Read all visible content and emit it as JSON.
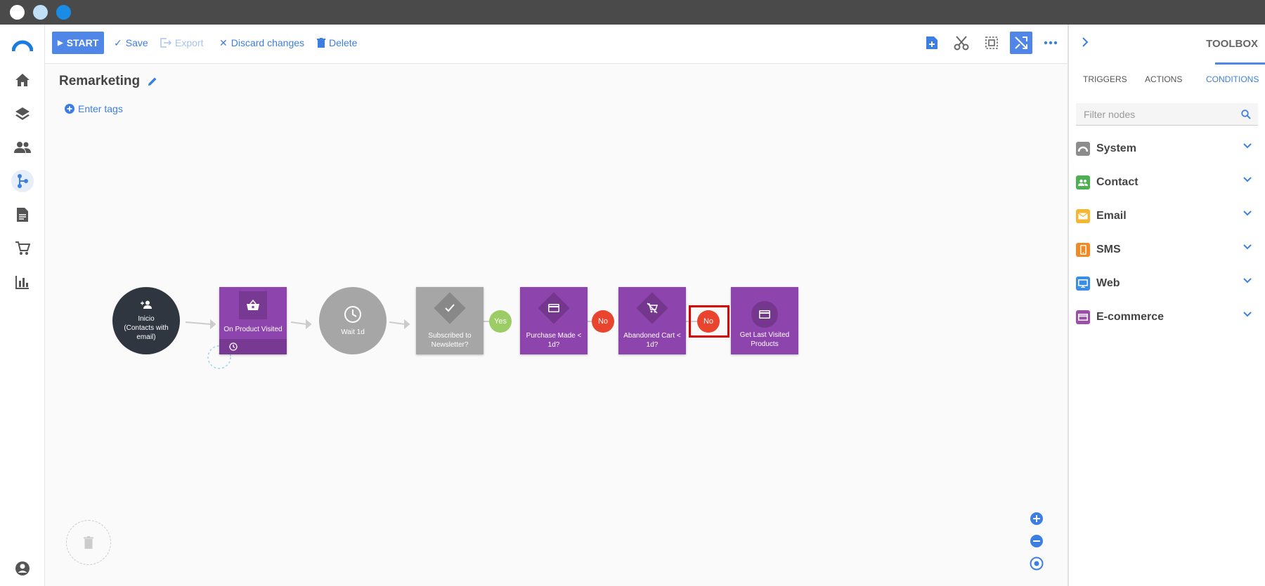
{
  "window": {
    "dots": [
      "#ffffff",
      "#bfe0f7",
      "#1a8ce6"
    ]
  },
  "toolbar": {
    "start_label": "START",
    "save_label": "Save",
    "export_label": "Export",
    "discard_label": "Discard changes",
    "delete_label": "Delete"
  },
  "flow": {
    "name": "Remarketing",
    "tags_label": "Enter tags",
    "nodes": {
      "start": "Inicio\n(Contacts with\nemail)",
      "product_visited": "On Product Visited",
      "wait": "Wait 1d",
      "subscribed": "Subscribed to\nNewsletter?",
      "purchase": "Purchase Made < 1d?",
      "abandoned": "Abandoned Cart < 1d?",
      "last_visited": "Get Last Visited\nProducts"
    },
    "branches": {
      "yes": "Yes",
      "no1": "No",
      "no2": "No"
    }
  },
  "toolbox": {
    "title": "TOOLBOX",
    "tabs": [
      "TRIGGERS",
      "ACTIONS",
      "CONDITIONS"
    ],
    "active_tab": "CONDITIONS",
    "filter_placeholder": "Filter nodes",
    "categories": [
      {
        "label": "System",
        "color": "#8c8c8c"
      },
      {
        "label": "Contact",
        "color": "#4caf50"
      },
      {
        "label": "Email",
        "color": "#f5b731"
      },
      {
        "label": "SMS",
        "color": "#f08a24"
      },
      {
        "label": "Web",
        "color": "#3a8ee6"
      },
      {
        "label": "E-commerce",
        "color": "#9b4fa8"
      }
    ]
  },
  "colors": {
    "accent": "#4f86e8",
    "purple": "#8e44ad",
    "gray": "#a6a6a6",
    "dark": "#2f3640",
    "no": "#e8442e",
    "yes": "#9ccc65"
  }
}
